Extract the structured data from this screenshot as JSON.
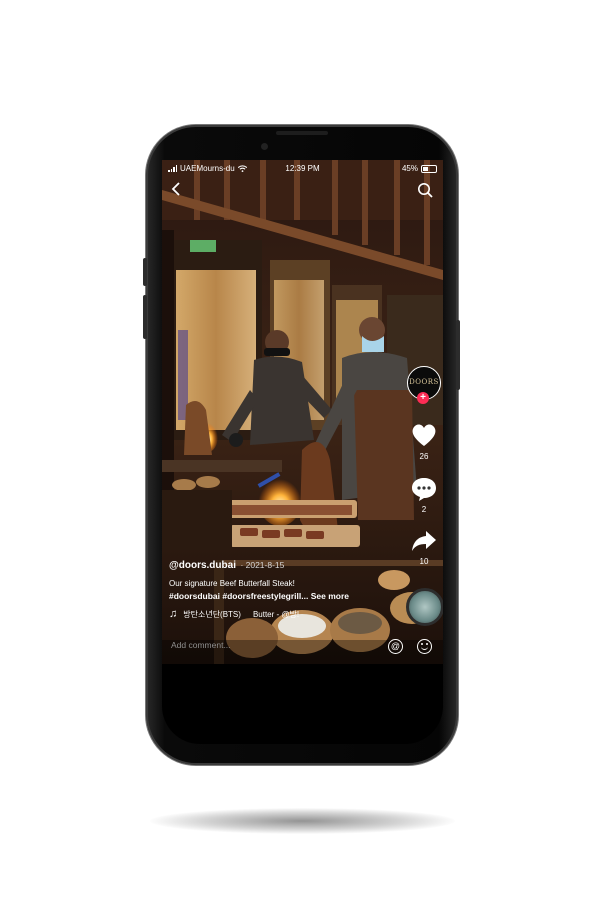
{
  "status_bar": {
    "carrier": "UAEMourns-du",
    "time": "12:39 PM",
    "battery": "45%"
  },
  "sidebar": {
    "avatar_text": "DOORS",
    "likes": "26",
    "comments": "2",
    "shares": "10"
  },
  "caption": {
    "username": "@doors.dubai",
    "date": "· 2021-8-15",
    "text": "Our signature Beef Butterfall Steak!",
    "hashtags": "#doorsdubai #doorsfreestylegrill... See more",
    "music_artist": "방탄소년단(BTS)",
    "music_title": "Butter - @방!"
  },
  "comment_bar": {
    "placeholder": "Add comment..."
  },
  "colors": {
    "follow": "#fe2c55",
    "phone": "#050505",
    "background": "#ffffff"
  }
}
